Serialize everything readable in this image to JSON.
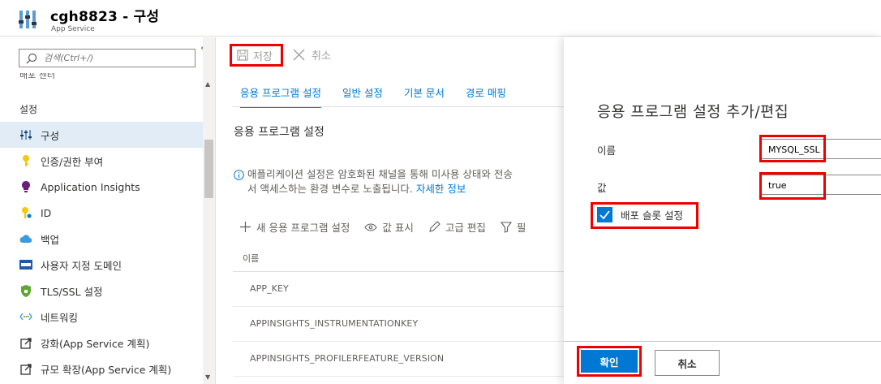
{
  "header": {
    "title": "cgh8823 - 구성",
    "subtitle": "App Service"
  },
  "sidebar": {
    "search_placeholder": "검색(Ctrl+/)",
    "collapse_glyph": "«",
    "cut_item": "배포 센터",
    "section_label": "설정",
    "items": [
      {
        "label": "구성",
        "icon": "config-sliders-icon",
        "active": true
      },
      {
        "label": "인증/권한 부여",
        "icon": "key-icon"
      },
      {
        "label": "Application Insights",
        "icon": "lightbulb-icon"
      },
      {
        "label": "ID",
        "icon": "identity-key-icon"
      },
      {
        "label": "백업",
        "icon": "cloud-backup-icon"
      },
      {
        "label": "사용자 지정 도메인",
        "icon": "www-domain-icon"
      },
      {
        "label": "TLS/SSL 설정",
        "icon": "shield-icon"
      },
      {
        "label": "네트워킹",
        "icon": "network-icon"
      },
      {
        "label": "강화(App Service 계획)",
        "icon": "scale-up-icon"
      },
      {
        "label": "규모 확장(App Service 계획)",
        "icon": "scale-out-icon"
      }
    ]
  },
  "toolbar": {
    "save_label": "저장",
    "cancel_label": "취소"
  },
  "tabs": [
    "응용 프로그램 설정",
    "일반 설정",
    "기본 문서",
    "경로 매핑"
  ],
  "main": {
    "heading": "응용 프로그램 설정",
    "info_line1": "애플리케이션 설정은 암호화된 채널을 통해 미사용 상태와 전송",
    "info_line2": "서 액세스하는 환경 변수로 노출됩니다.",
    "info_link": "자세한 정보",
    "commands": {
      "new_setting": "새 응용 프로그램 설정",
      "show_values": "값 표시",
      "advanced_edit": "고급 편집",
      "filter": "필"
    },
    "column_name": "이름",
    "rows": [
      "APP_KEY",
      "APPINSIGHTS_INSTRUMENTATIONKEY",
      "APPINSIGHTS_PROFILERFEATURE_VERSION"
    ]
  },
  "panel": {
    "title": "응용 프로그램 설정 추가/편집",
    "name_label": "이름",
    "name_value": "MYSQL_SSL",
    "value_label": "값",
    "value_value": "true",
    "slot_label": "배포 슬롯 설정",
    "ok_label": "확인",
    "cancel_label": "취소"
  },
  "colors": {
    "accent": "#0078d4",
    "highlight": "#ee0000"
  }
}
